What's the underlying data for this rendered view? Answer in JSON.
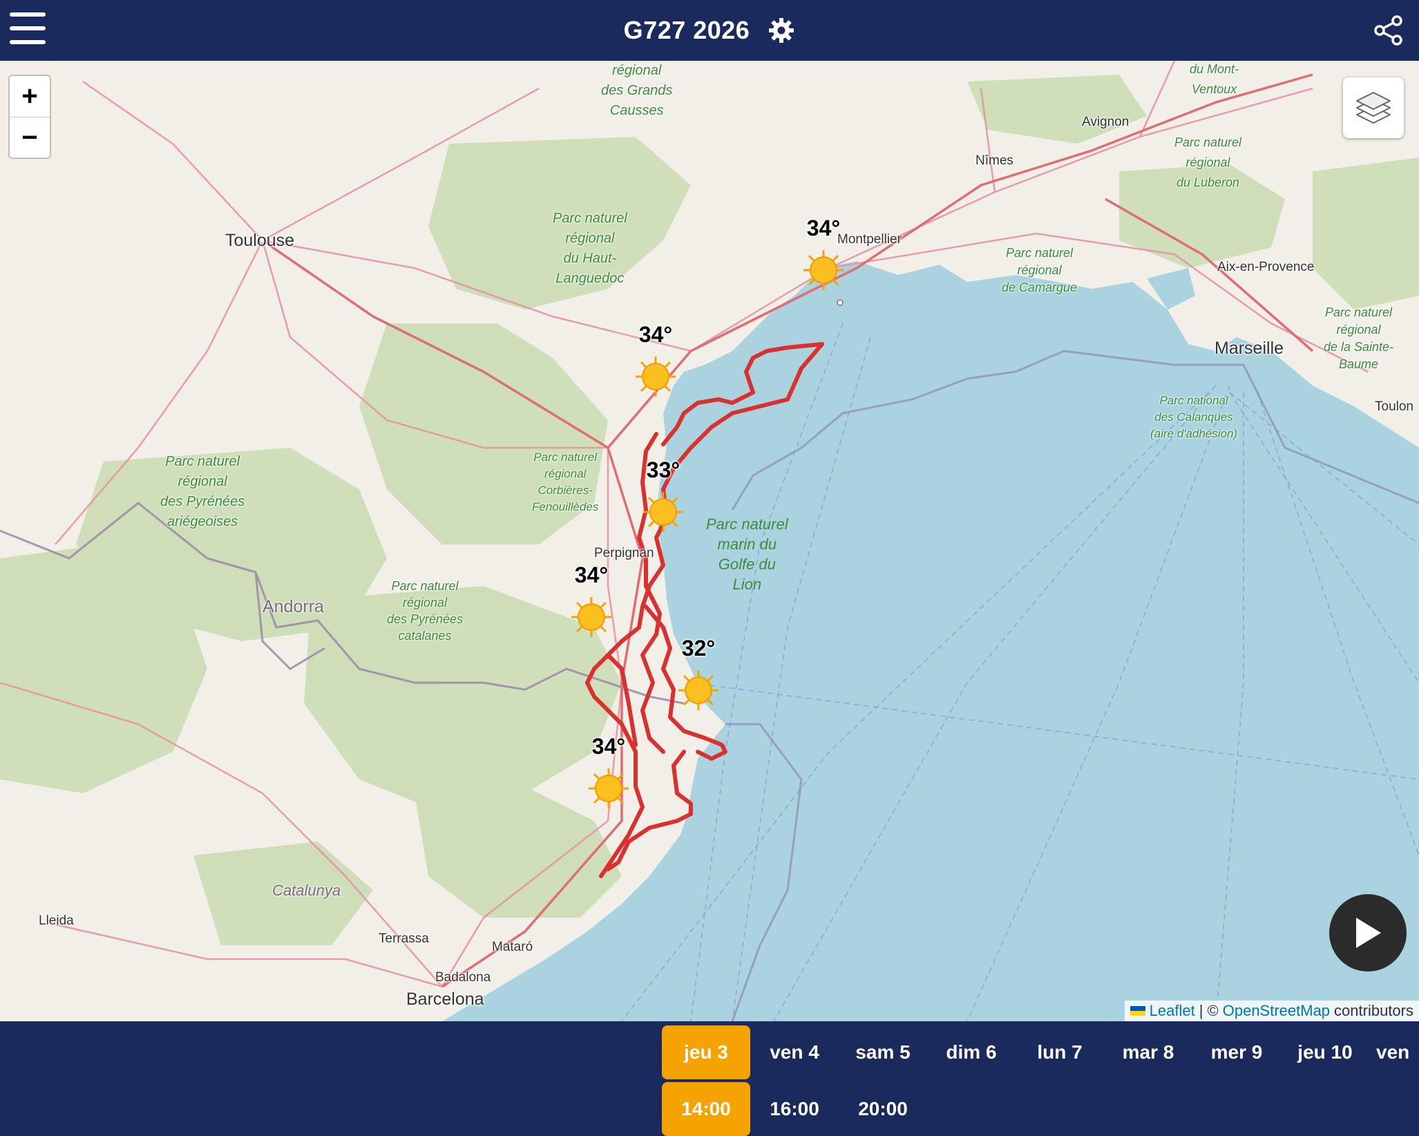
{
  "header": {
    "title": "G727 2026",
    "menu_icon": "hamburger-menu-icon",
    "settings_icon": "gear-icon",
    "share_icon": "share-icon"
  },
  "map": {
    "zoom_in": "+",
    "zoom_out": "−",
    "layers_icon": "layers-icon",
    "places": {
      "toulouse": "Toulouse",
      "montpellier": "Montpellier",
      "nimes": "Nîmes",
      "avignon": "Avignon",
      "aix": "Aix-en-Provence",
      "marseille": "Marseille",
      "toulon": "Toulon",
      "perpignan": "Perpignan",
      "andorra": "Andorra",
      "catalunya": "Catalunya",
      "lleida": "Lleida",
      "terrassa": "Terrassa",
      "mataro": "Mataró",
      "badalona": "Badalona",
      "barcelona": "Barcelona"
    },
    "parks": {
      "grands_causses": "régional\ndes Grands\nCausses",
      "mont_ventoux": "du Mont-\nVentoux",
      "luberon": "Parc naturel\nrégional\ndu Luberon",
      "haut_languedoc": "Parc naturel\nrégional\ndu Haut-\nLanguedoc",
      "camargue": "Parc naturel\nrégional\nde Camargue",
      "sainte_baume": "Parc naturel\nrégional\nde la Sainte-\nBaume",
      "calanques": "Parc national\ndes Calanques\n(aire d'adhésion)",
      "corbieres": "Parc naturel\nrégional\nCorbières-\nFenouillèdes",
      "pyrenees_ariegeoises": "Parc naturel\nrégional\ndes Pyrénées\nariégeoises",
      "pyrenees_catalanes": "Parc naturel\nrégional\ndes Pyrénées\ncatalanes",
      "golfe_lion": "Parc naturel\nmarin du\nGolfe du\nLion"
    },
    "weather_markers": [
      {
        "temp": "34°",
        "icon": "sun-icon"
      },
      {
        "temp": "34°",
        "icon": "sun-icon"
      },
      {
        "temp": "33°",
        "icon": "sun-icon"
      },
      {
        "temp": "34°",
        "icon": "sun-icon"
      },
      {
        "temp": "32°",
        "icon": "sun-icon"
      },
      {
        "temp": "34°",
        "icon": "sun-icon"
      }
    ],
    "route_color": "#d93030",
    "play_icon": "play-icon",
    "attribution": {
      "leaflet": "Leaflet",
      "separator": "| ©",
      "osm": "OpenStreetMap",
      "contributors": "contributors"
    }
  },
  "days": [
    "jeu 3",
    "ven 4",
    "sam 5",
    "dim 6",
    "lun 7",
    "mar 8",
    "mer 9",
    "jeu 10",
    "ven"
  ],
  "selected_day": "jeu 3",
  "times": [
    "14:00",
    "16:00",
    "20:00"
  ],
  "selected_time": "14:00",
  "colors": {
    "header": "#1a2a5c",
    "accent": "#f5a300",
    "sea": "#aad3df",
    "land": "#f2efe9"
  }
}
